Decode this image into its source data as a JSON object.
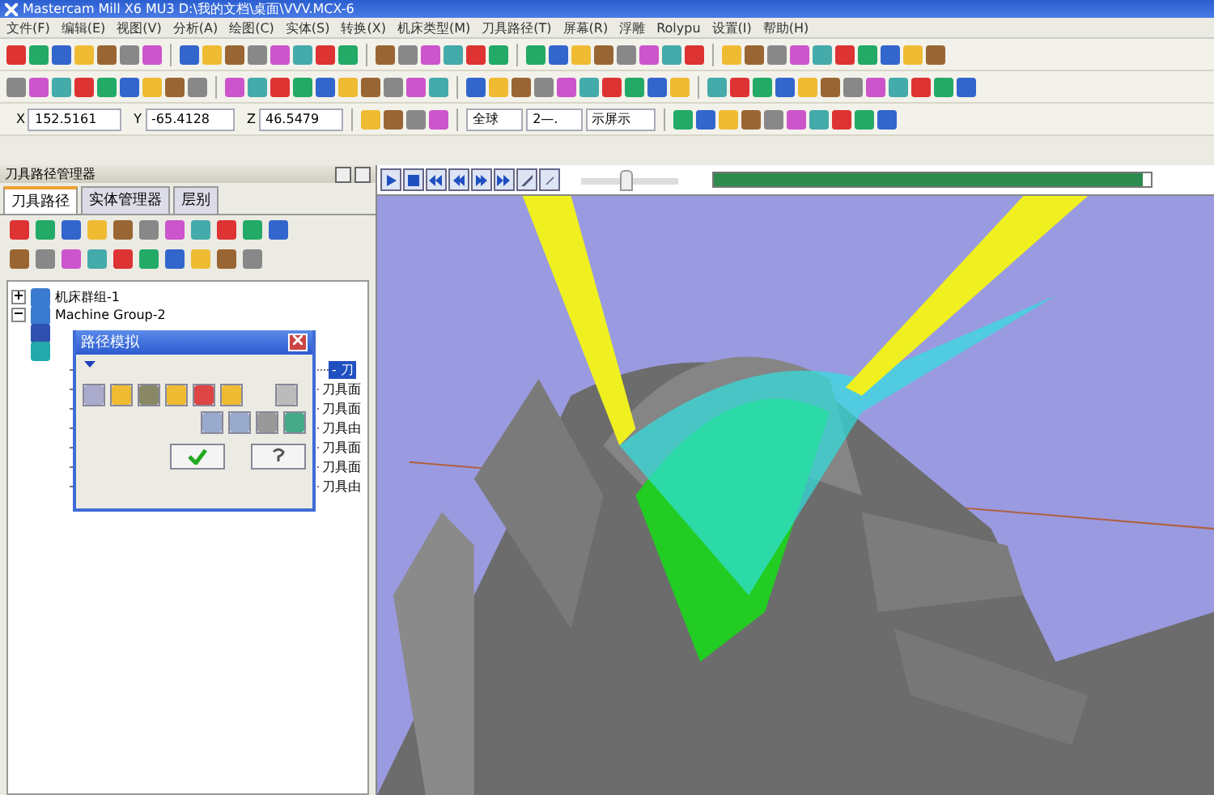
{
  "window": {
    "title": "Mastercam Mill X6 MU3 D:\\我的文档\\桌面\\VVV.MCX-6"
  },
  "menu": [
    "文件(F)",
    "编辑(E)",
    "视图(V)",
    "分析(A)",
    "绘图(C)",
    "实体(S)",
    "转换(X)",
    "机床类型(M)",
    "刀具路径(T)",
    "屏幕(R)",
    "浮雕",
    "Rolypu",
    "设置(I)",
    "帮助(H)"
  ],
  "coordinates": [
    {
      "axis": "X",
      "value": "152.5161"
    },
    {
      "axis": "Y",
      "value": "-65.4128"
    },
    {
      "axis": "Z",
      "value": "46.5479"
    }
  ],
  "combos": [
    {
      "value": "全球"
    },
    {
      "value": "2—."
    },
    {
      "value": "示屏示"
    }
  ],
  "simulation": {
    "speed": {
      "level": 0.45
    },
    "progress": {
      "level": 0.98
    }
  },
  "manager": {
    "title": "刀具路径管理器",
    "tabs": [
      {
        "label": "刀具路径",
        "selected": true
      },
      {
        "label": "实体管理器",
        "selected": false
      },
      {
        "label": "层别",
        "selected": false
      }
    ],
    "tree": [
      {
        "label": "机床群组-1",
        "expanded": false
      },
      {
        "label": "Machine Group-2",
        "expanded": true,
        "children": [
          {
            "label": "- 刀",
            "selected": true
          },
          {
            "label": "刀具面",
            "selected": false
          },
          {
            "label": "刀具面",
            "selected": false
          },
          {
            "label": "刀具由",
            "selected": false
          },
          {
            "label": "刀具面",
            "selected": false
          },
          {
            "label": "刀具面",
            "selected": false
          },
          {
            "label": "刀具由",
            "selected": false
          }
        ]
      }
    ]
  },
  "dialog": {
    "title": "路径模拟"
  }
}
